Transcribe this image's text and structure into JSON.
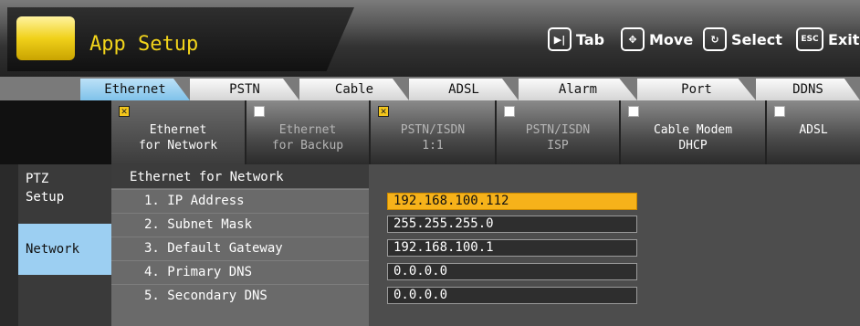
{
  "header": {
    "title": "App Setup",
    "hints": [
      {
        "icon": "tab-key-icon",
        "key": "▶|",
        "label": "Tab"
      },
      {
        "icon": "move-key-icon",
        "key": "✥",
        "label": "Move"
      },
      {
        "icon": "select-key-icon",
        "key": "↻",
        "label": "Select"
      },
      {
        "icon": "esc-key-icon",
        "key": "ESC",
        "label": "Exit"
      }
    ]
  },
  "tabs": [
    "Ethernet",
    "PSTN",
    "Cable",
    "ADSL",
    "Alarm",
    "Port",
    "DDNS"
  ],
  "active_tab": "Ethernet",
  "options": [
    {
      "label": "Ethernet\nfor Network",
      "checked": true,
      "enabled": true
    },
    {
      "label": "Ethernet\nfor Backup",
      "checked": false,
      "enabled": false
    },
    {
      "label": "PSTN/ISDN\n1:1",
      "checked": true,
      "enabled": false
    },
    {
      "label": "PSTN/ISDN\nISP",
      "checked": false,
      "enabled": false
    },
    {
      "label": "Cable Modem\nDHCP",
      "checked": false,
      "enabled": true
    },
    {
      "label": "ADSL",
      "checked": false,
      "enabled": true
    }
  ],
  "nav": {
    "ptz": "PTZ\nSetup",
    "network": "Network"
  },
  "panel": {
    "title": "Ethernet for Network",
    "rows": [
      {
        "label": "1. IP Address",
        "value": "192.168.100.112",
        "selected": true
      },
      {
        "label": "2. Subnet Mask",
        "value": "255.255.255.0",
        "selected": false
      },
      {
        "label": "3. Default Gateway",
        "value": "192.168.100.1",
        "selected": false
      },
      {
        "label": "4. Primary DNS",
        "value": "0.0.0.0",
        "selected": false
      },
      {
        "label": "5. Secondary DNS",
        "value": "0.0.0.0",
        "selected": false
      }
    ]
  },
  "colors": {
    "accent": "#f6b21a",
    "tab_active": "#9ccff2",
    "title": "#f2d41b"
  }
}
